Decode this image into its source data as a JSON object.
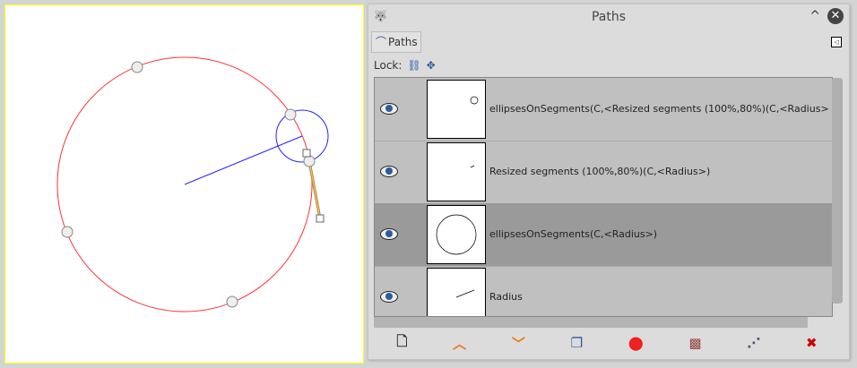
{
  "dialog": {
    "title": "Paths",
    "tab_label": "Paths",
    "lock_label": "Lock:"
  },
  "paths": [
    {
      "name": "ellipsesOnSegments(C,<Resized segments (100%,80%)(C,<Radius>",
      "selected": false
    },
    {
      "name": "Resized segments (100%,80%)(C,<Radius>)",
      "selected": false
    },
    {
      "name": "ellipsesOnSegments(C,<Radius>)",
      "selected": true
    },
    {
      "name": "Radius",
      "selected": false
    }
  ],
  "buttons": [
    "new-path",
    "raise-path",
    "lower-path",
    "duplicate-path",
    "path-to-selection",
    "selection-to-path",
    "paint-along-path",
    "delete-path"
  ],
  "colors": {
    "path_red": "#ff3333",
    "path_blue": "#2222ff",
    "handle": "#e0b060"
  }
}
